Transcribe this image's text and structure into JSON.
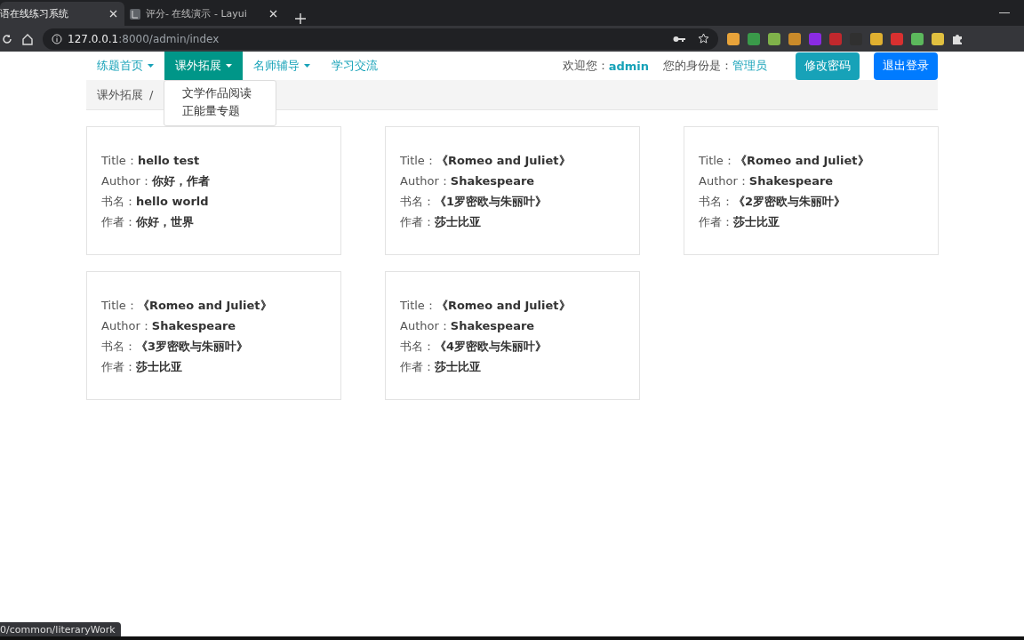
{
  "browser": {
    "tabs": [
      {
        "title": "语在线练习系统",
        "selected": true
      },
      {
        "title": "评分- 在线演示 - Layui",
        "selected": false
      }
    ],
    "address": {
      "host": "127.0.0.1",
      "rest": ":8000/admin/index"
    },
    "extensions": [
      {
        "color": "#e8a33a"
      },
      {
        "color": "#3a9a4a"
      },
      {
        "color": "#7fb24a"
      },
      {
        "color": "#c98a2a"
      },
      {
        "color": "#8a2be2"
      },
      {
        "color": "#c0282d"
      },
      {
        "color": "#303030"
      },
      {
        "color": "#e0b030"
      },
      {
        "color": "#d93030"
      },
      {
        "color": "#5cb85c"
      },
      {
        "color": "#e0c040"
      }
    ]
  },
  "nav": {
    "items": [
      {
        "label": "练题首页",
        "dropdown": true,
        "selected": false
      },
      {
        "label": "课外拓展",
        "dropdown": true,
        "selected": true
      },
      {
        "label": "名师辅导",
        "dropdown": true,
        "selected": false
      },
      {
        "label": "学习交流",
        "dropdown": false,
        "selected": false
      }
    ],
    "welcome_label": "欢迎您：",
    "user": "admin",
    "role_label": "您的身份是：",
    "role": "管理员",
    "buttons": [
      {
        "label": "修改密码",
        "kind": "info"
      },
      {
        "label": "退出登录",
        "kind": "primary"
      }
    ]
  },
  "dropdown_menu": [
    "文学作品阅读",
    "正能量专题"
  ],
  "breadcrumb": {
    "items": [
      "课外拓展"
    ],
    "separator": "/"
  },
  "cards": [
    {
      "fields": [
        {
          "label": "Title：",
          "value": "hello test"
        },
        {
          "label": "Author：",
          "value": "你好，作者"
        },
        {
          "label": "书名：",
          "value": "hello world"
        },
        {
          "label": "作者：",
          "value": "你好，世界"
        }
      ]
    },
    {
      "fields": [
        {
          "label": "Title：",
          "value": "《Romeo and Juliet》"
        },
        {
          "label": "Author：",
          "value": "Shakespeare"
        },
        {
          "label": "书名：",
          "value": "《1罗密欧与朱丽叶》"
        },
        {
          "label": "作者：",
          "value": "莎士比亚"
        }
      ]
    },
    {
      "fields": [
        {
          "label": "Title：",
          "value": "《Romeo and Juliet》"
        },
        {
          "label": "Author：",
          "value": "Shakespeare"
        },
        {
          "label": "书名：",
          "value": "《2罗密欧与朱丽叶》"
        },
        {
          "label": "作者：",
          "value": "莎士比亚"
        }
      ]
    },
    {
      "fields": [
        {
          "label": "Title：",
          "value": "《Romeo and Juliet》"
        },
        {
          "label": "Author：",
          "value": "Shakespeare"
        },
        {
          "label": "书名：",
          "value": "《3罗密欧与朱丽叶》"
        },
        {
          "label": "作者：",
          "value": "莎士比亚"
        }
      ]
    },
    {
      "fields": [
        {
          "label": "Title：",
          "value": "《Romeo and Juliet》"
        },
        {
          "label": "Author：",
          "value": "Shakespeare"
        },
        {
          "label": "书名：",
          "value": "《4罗密欧与朱丽叶》"
        },
        {
          "label": "作者：",
          "value": "莎士比亚"
        }
      ]
    }
  ],
  "status_url": "0/common/literaryWork"
}
